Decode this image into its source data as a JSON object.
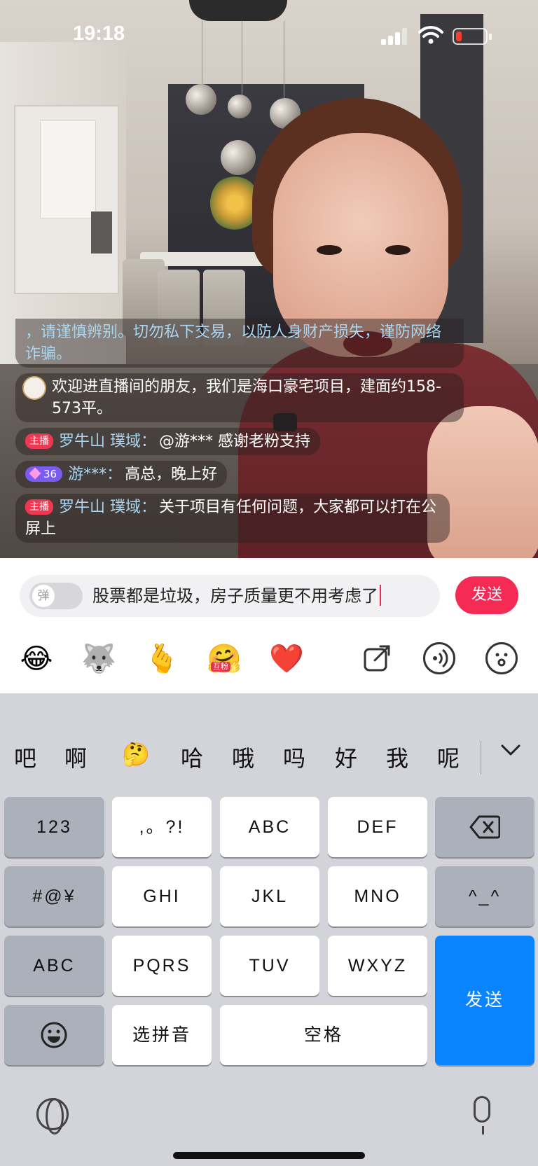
{
  "status_bar": {
    "time": "19:18",
    "battery_color": "#ff3b30"
  },
  "comments": [
    {
      "type": "system",
      "text": "，请谨慎辨别。切勿私下交易，以防人身财产损失，谨防网络诈骗。"
    },
    {
      "type": "welcome",
      "text": "欢迎进直播间的朋友，我们是海口豪宅项目，建面约158-573平。"
    },
    {
      "type": "host",
      "badge": "主播",
      "name": "罗牛山 璞域：",
      "text": "@游*** 感谢老粉支持"
    },
    {
      "type": "user",
      "level": "36",
      "name": "游***：",
      "text": "高总，晚上好"
    },
    {
      "type": "host",
      "badge": "主播",
      "name": "罗牛山 璞域：",
      "text": "关于项目有任何问题，大家都可以打在公屏上"
    }
  ],
  "input_bar": {
    "toggle_label": "弹",
    "text": "股票都是垃圾，房子质量更不用考虑了",
    "send_label": "发送",
    "send_color": "#f52b55"
  },
  "emoji_row": {
    "emojis": [
      "laughing-crying-emoji",
      "husky-dog-emoji",
      "finger-heart-emoji",
      "hug-emoji",
      "red-heart-emoji"
    ],
    "glyphs": [
      "😂",
      "🐺",
      "🫰",
      "🤗",
      "❤️"
    ],
    "hug_sticker_text": "互粉",
    "tools": [
      "share-icon",
      "voice-icon",
      "smiley-icon"
    ]
  },
  "keyboard": {
    "candidates": [
      "吧",
      "啊",
      "🤔",
      "哈",
      "哦",
      "吗",
      "好",
      "我",
      "呢"
    ],
    "rows": {
      "r1": [
        "123",
        ",。?!",
        "ABC",
        "DEF"
      ],
      "r2": [
        "#@¥",
        "GHI",
        "JKL",
        "MNO",
        "^_^"
      ],
      "r3": [
        "ABC",
        "PQRS",
        "TUV",
        "WXYZ"
      ],
      "r4": [
        "选拼音",
        "空格"
      ]
    },
    "send_label": "发送",
    "send_color": "#0a84ff"
  }
}
